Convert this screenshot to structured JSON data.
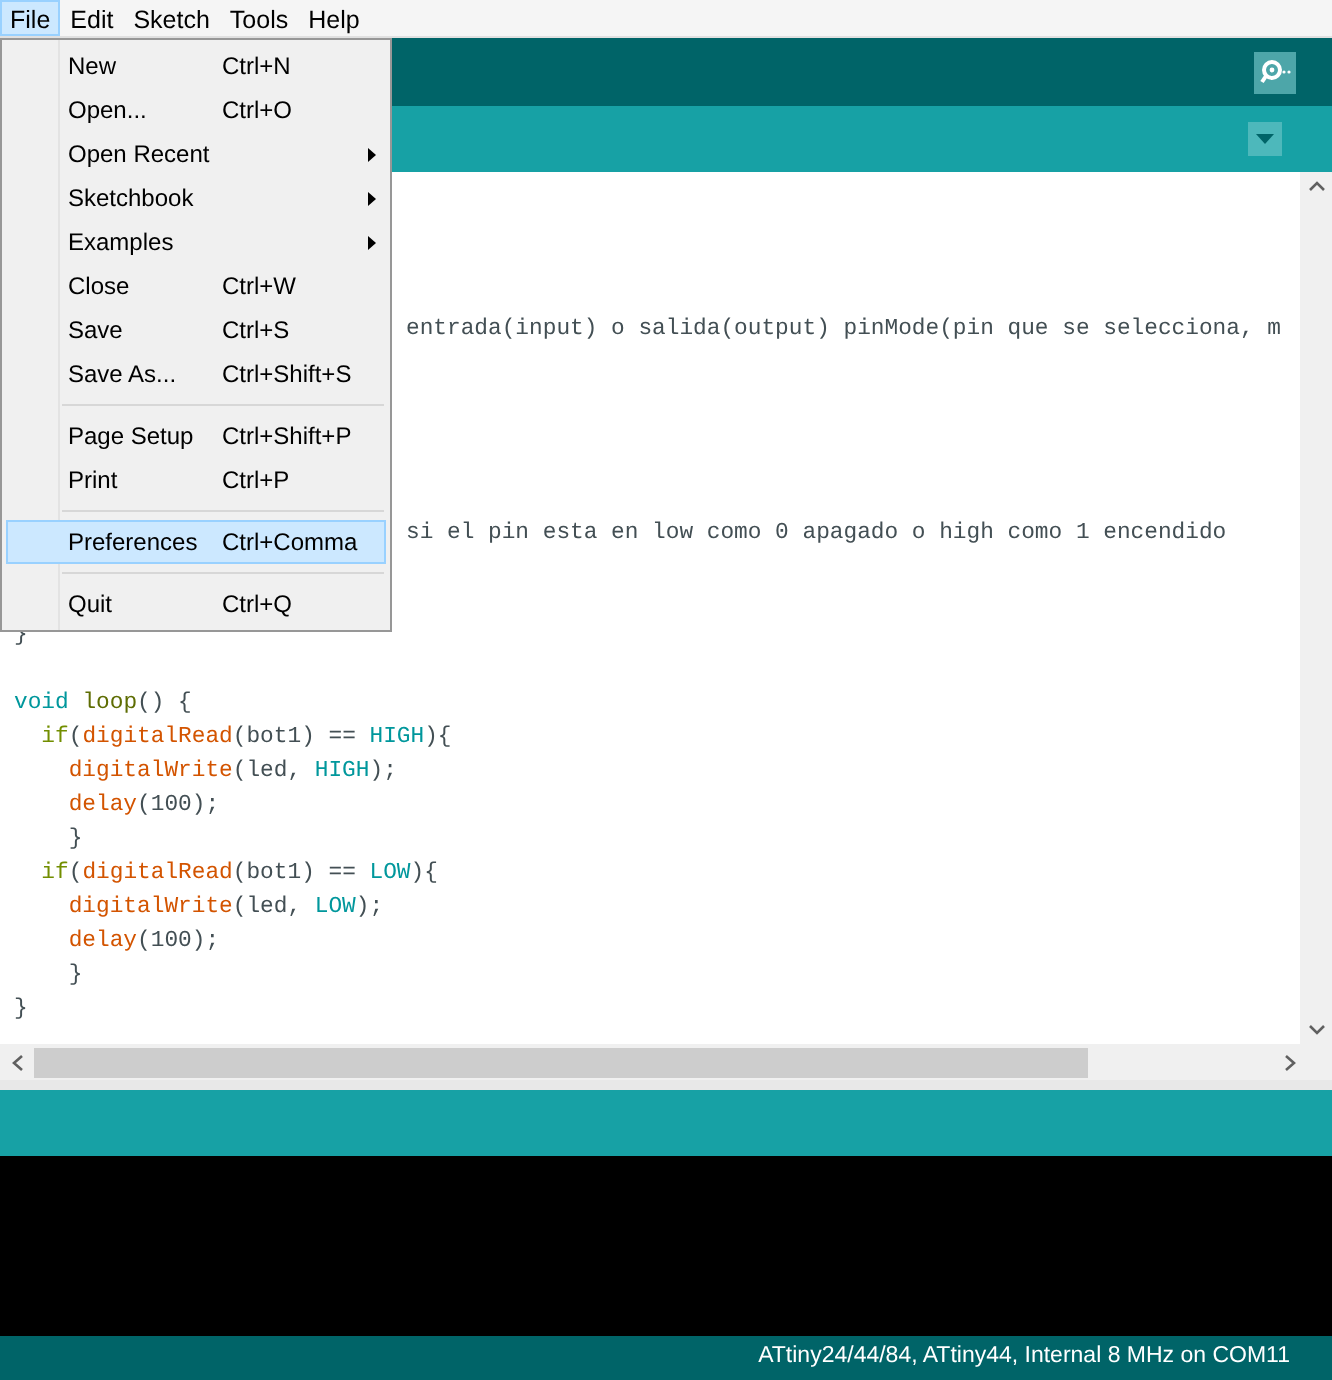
{
  "menubar": [
    {
      "label": "File",
      "selected": true
    },
    {
      "label": "Edit",
      "selected": false
    },
    {
      "label": "Sketch",
      "selected": false
    },
    {
      "label": "Tools",
      "selected": false
    },
    {
      "label": "Help",
      "selected": false
    }
  ],
  "file_menu": [
    {
      "kind": "item",
      "label": "New",
      "shortcut": "Ctrl+N",
      "submenu": false,
      "selected": false
    },
    {
      "kind": "item",
      "label": "Open...",
      "shortcut": "Ctrl+O",
      "submenu": false,
      "selected": false
    },
    {
      "kind": "item",
      "label": "Open Recent",
      "submenu": true,
      "selected": false
    },
    {
      "kind": "item",
      "label": "Sketchbook",
      "submenu": true,
      "selected": false
    },
    {
      "kind": "item",
      "label": "Examples",
      "submenu": true,
      "selected": false
    },
    {
      "kind": "item",
      "label": "Close",
      "shortcut": "Ctrl+W",
      "submenu": false,
      "selected": false
    },
    {
      "kind": "item",
      "label": "Save",
      "shortcut": "Ctrl+S",
      "submenu": false,
      "selected": false
    },
    {
      "kind": "item",
      "label": "Save As...",
      "shortcut": "Ctrl+Shift+S",
      "submenu": false,
      "selected": false
    },
    {
      "kind": "separator"
    },
    {
      "kind": "item",
      "label": "Page Setup",
      "shortcut": "Ctrl+Shift+P",
      "submenu": false,
      "selected": false
    },
    {
      "kind": "item",
      "label": "Print",
      "shortcut": "Ctrl+P",
      "submenu": false,
      "selected": false
    },
    {
      "kind": "separator"
    },
    {
      "kind": "item",
      "label": "Preferences",
      "shortcut": "Ctrl+Comma",
      "submenu": false,
      "selected": true
    },
    {
      "kind": "separator"
    },
    {
      "kind": "item",
      "label": "Quit",
      "shortcut": "Ctrl+Q",
      "submenu": false,
      "selected": false
    }
  ],
  "editor": {
    "lines": [
      {
        "kind": "blank"
      },
      {
        "kind": "blank"
      },
      {
        "kind": "blank"
      },
      {
        "kind": "blank"
      },
      {
        "kind": "partial",
        "tokens": [
          {
            "kind": "comment",
            "text": "entrada(input) o salida(output) pinMode(pin que se selecciona, m"
          }
        ]
      },
      {
        "kind": "blank"
      },
      {
        "kind": "blank"
      },
      {
        "kind": "blank"
      },
      {
        "kind": "blank"
      },
      {
        "kind": "blank"
      },
      {
        "kind": "partial",
        "tokens": [
          {
            "kind": "comment",
            "text": "si el pin esta en low como 0 apagado o high como 1 encendido"
          }
        ]
      },
      {
        "kind": "blank"
      },
      {
        "kind": "blank"
      },
      {
        "kind": "code",
        "tokens": [
          {
            "kind": "plain",
            "text": "}"
          }
        ]
      },
      {
        "kind": "blank"
      },
      {
        "kind": "code",
        "tokens": [
          {
            "kind": "keyword",
            "text": "void "
          },
          {
            "kind": "structure",
            "text": "loop"
          },
          {
            "kind": "plain",
            "text": "() {"
          }
        ]
      },
      {
        "kind": "code",
        "tokens": [
          {
            "kind": "control",
            "text": "  if"
          },
          {
            "kind": "plain",
            "text": "("
          },
          {
            "kind": "function",
            "text": "digitalRead"
          },
          {
            "kind": "plain",
            "text": "(bot1) == "
          },
          {
            "kind": "constant",
            "text": "HIGH"
          },
          {
            "kind": "plain",
            "text": "){"
          }
        ]
      },
      {
        "kind": "code",
        "tokens": [
          {
            "kind": "function",
            "text": "    digitalWrite"
          },
          {
            "kind": "plain",
            "text": "(led, "
          },
          {
            "kind": "constant",
            "text": "HIGH"
          },
          {
            "kind": "plain",
            "text": ");"
          }
        ]
      },
      {
        "kind": "code",
        "tokens": [
          {
            "kind": "function",
            "text": "    delay"
          },
          {
            "kind": "plain",
            "text": "(100);"
          }
        ]
      },
      {
        "kind": "code",
        "tokens": [
          {
            "kind": "plain",
            "text": "    }"
          }
        ]
      },
      {
        "kind": "code",
        "tokens": [
          {
            "kind": "control",
            "text": "  if"
          },
          {
            "kind": "plain",
            "text": "("
          },
          {
            "kind": "function",
            "text": "digitalRead"
          },
          {
            "kind": "plain",
            "text": "(bot1) == "
          },
          {
            "kind": "constant",
            "text": "LOW"
          },
          {
            "kind": "plain",
            "text": "){"
          }
        ]
      },
      {
        "kind": "code",
        "tokens": [
          {
            "kind": "function",
            "text": "    digitalWrite"
          },
          {
            "kind": "plain",
            "text": "(led, "
          },
          {
            "kind": "constant",
            "text": "LOW"
          },
          {
            "kind": "plain",
            "text": ");"
          }
        ]
      },
      {
        "kind": "code",
        "tokens": [
          {
            "kind": "function",
            "text": "    delay"
          },
          {
            "kind": "plain",
            "text": "(100);"
          }
        ]
      },
      {
        "kind": "code",
        "tokens": [
          {
            "kind": "plain",
            "text": "    }"
          }
        ]
      },
      {
        "kind": "code",
        "tokens": [
          {
            "kind": "plain",
            "text": "}"
          }
        ]
      }
    ]
  },
  "status_bar": {
    "board": "ATtiny24/44/84, ATtiny44, Internal 8 MHz on COM11"
  }
}
